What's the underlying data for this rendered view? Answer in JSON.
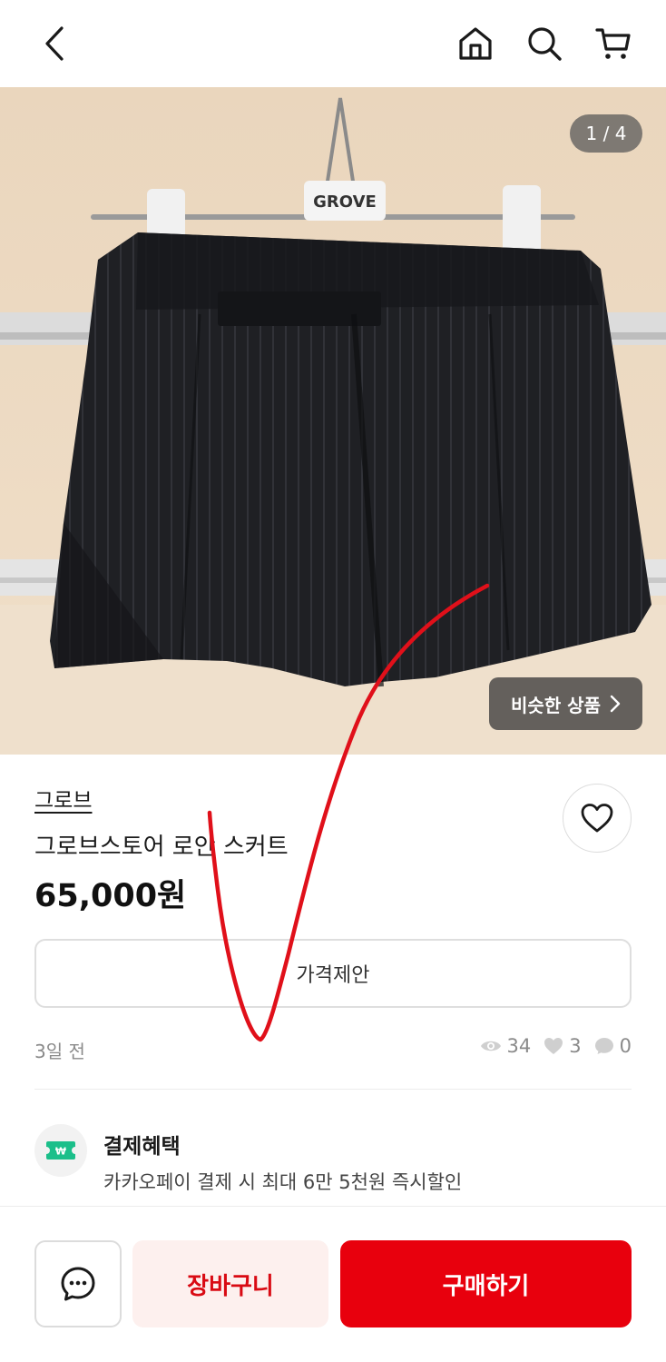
{
  "header": {
    "back_icon": "chevron-left-icon",
    "home_icon": "home-icon",
    "search_icon": "search-icon",
    "cart_icon": "shopping-cart-icon"
  },
  "gallery": {
    "counter": "1 / 4",
    "similar_label": "비슷한 상품",
    "hanger_tag": "GROVE"
  },
  "product": {
    "brand": "그로브",
    "title": "그로브스토어 로안 스커트",
    "price": "65,000원",
    "offer_button": "가격제안",
    "posted": "3일 전",
    "views": "34",
    "likes": "3",
    "chats": "0"
  },
  "benefit": {
    "title": "결제혜택",
    "description": "카카오페이 결제 시 최대 6만 5천원 즉시할인"
  },
  "bottom_bar": {
    "cart_label": "장바구니",
    "buy_label": "구매하기"
  },
  "colors": {
    "accent": "#e8000d",
    "cart_bg": "#fdf0ee",
    "cart_text": "#d90a13",
    "benefit_icon": "#1bbf8a"
  }
}
